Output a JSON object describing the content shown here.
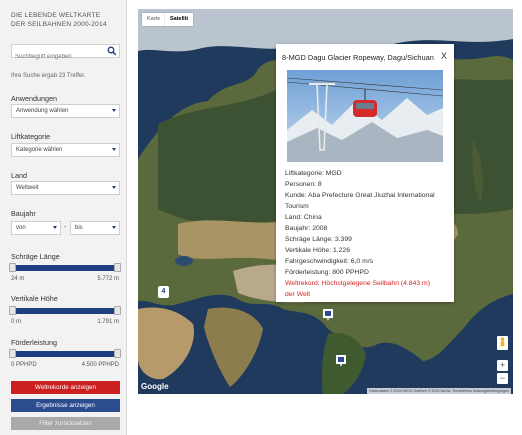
{
  "sidebar": {
    "title_line1": "DIE LEBENDE WELTKARTE",
    "title_line2": "DER SEILBAHNEN 2000-2014",
    "search_placeholder": "Suchbegriff eingeben",
    "result_note": "Ihre Suche ergab 23 Treffer.",
    "filters": {
      "anwendungen_label": "Anwendungen",
      "anwendungen_value": "Anwendung wählen",
      "liftkategorie_label": "Liftkategorie",
      "liftkategorie_value": "Kategorie wählen",
      "land_label": "Land",
      "land_value": "Weltweit",
      "baujahr_label": "Baujahr",
      "baujahr_from": "von",
      "baujahr_sep": "-",
      "baujahr_to": "bis"
    },
    "sliders": [
      {
        "label": "Schräge Länge",
        "min": "24 m",
        "max": "5.772 m",
        "range": [
          0,
          1
        ]
      },
      {
        "label": "Vertikale Höhe",
        "min": "0 m",
        "max": "1.791 m",
        "range": [
          0,
          1
        ]
      },
      {
        "label": "Förderleistung",
        "min": "0 PPHPD",
        "max": "4.500 PPHPD",
        "range": [
          0,
          1
        ]
      }
    ],
    "buttons": {
      "weltrekorde": "Weltrekorde anzeigen",
      "ergebnisse": "Ergebnisse anzeigen",
      "zuruecksetzen": "Filter zurücksetzen"
    }
  },
  "map": {
    "type_karte": "Karte",
    "type_satellit": "Satellit",
    "cluster_count": "4",
    "google": "Google",
    "attribution": "Kartendaten © 2015 INEGI Grafiken © 2015 NASA, TerraMetrics   Nutzungsbedingungen",
    "zoom_in": "+",
    "zoom_out": "−"
  },
  "info": {
    "title": "8-MGD Dagu Glacier Ropeway, Dagu/Sichuan",
    "close": "X",
    "lines": [
      "Liftkategorie: MGD",
      "Personen: 8",
      "Kunde: Aba Prefecture Great Jiuzhai International",
      "Tourism",
      "Land: China",
      "Baujahr: 2008",
      "Schräge Länge: 3.399",
      "Vertikale Höhe: 1.226",
      "Fahrgeschwindigkeit: 6,0 m/s",
      "Förderleistung: 800 PPHPD"
    ],
    "record_line1": "Weltrekord: Höchstgelegene Seilbahn (4.843 m)",
    "record_line2": "der Welt"
  },
  "colors": {
    "accent_blue": "#1e3f80",
    "record_red": "#cc1f1f",
    "ocean": "#1f3a5c"
  }
}
